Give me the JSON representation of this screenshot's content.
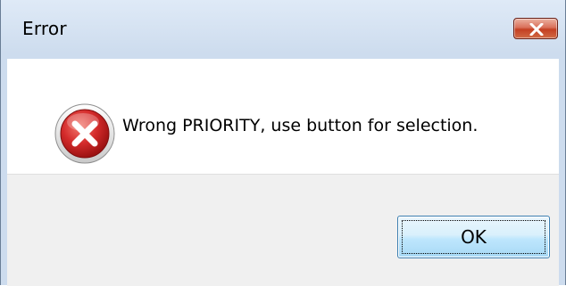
{
  "window": {
    "title": "Error",
    "close_icon": "close-x-icon"
  },
  "dialog": {
    "icon": "error-icon",
    "message": "Wrong PRIORITY, use button for selection.",
    "ok_label": "OK"
  },
  "colors": {
    "titlebar": "#cddcee",
    "close_button": "#c43f22",
    "footer": "#f0f0f0",
    "ok_button_border": "#3c7fb1",
    "error_icon_red": "#d42b2b"
  }
}
